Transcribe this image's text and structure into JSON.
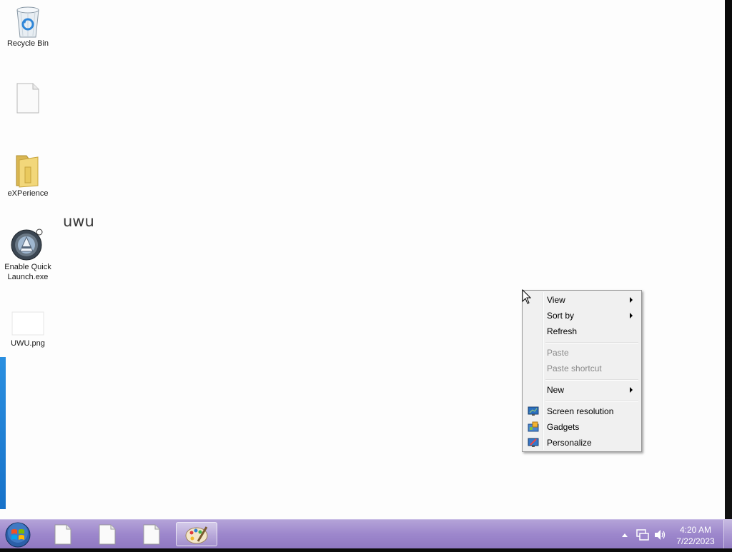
{
  "desktop": {
    "icons": [
      {
        "label": "Recycle Bin",
        "icon": "recycle-bin-icon"
      },
      {
        "label": "",
        "icon": "blank-file-icon"
      },
      {
        "label": "eXPerience",
        "icon": "folder-icon"
      },
      {
        "label": "Enable Quick Launch.exe",
        "icon": "app-launcher-icon"
      },
      {
        "label": "UWU.png",
        "icon": "image-file-icon"
      }
    ],
    "floating_text": "uwu"
  },
  "context_menu": {
    "items": [
      {
        "label": "View",
        "submenu": true,
        "enabled": true
      },
      {
        "label": "Sort by",
        "submenu": true,
        "enabled": true
      },
      {
        "label": "Refresh",
        "submenu": false,
        "enabled": true
      },
      {
        "label": "Paste",
        "submenu": false,
        "enabled": false
      },
      {
        "label": "Paste shortcut",
        "submenu": false,
        "enabled": false
      },
      {
        "label": "New",
        "submenu": true,
        "enabled": true
      },
      {
        "label": "Screen resolution",
        "submenu": false,
        "enabled": true,
        "icon": "screen-resolution-icon"
      },
      {
        "label": "Gadgets",
        "submenu": false,
        "enabled": true,
        "icon": "gadgets-icon"
      },
      {
        "label": "Personalize",
        "submenu": false,
        "enabled": true,
        "icon": "personalize-icon"
      }
    ]
  },
  "taskbar": {
    "start_icon": "windows-start-icon",
    "tasks": [
      {
        "icon": "document-icon",
        "active": false
      },
      {
        "icon": "document-icon",
        "active": false
      },
      {
        "icon": "document-icon",
        "active": false
      },
      {
        "icon": "paint-palette-icon",
        "active": true
      }
    ],
    "tray_icons": [
      "show-hidden-icons-icon",
      "network-icon",
      "volume-icon"
    ],
    "clock": {
      "time": "4:20 AM",
      "date": "7/22/2023"
    }
  },
  "colors": {
    "taskbar": "#9d87cc",
    "desktop_background": "#fdfdfd",
    "menu_background": "#f0f0f0"
  }
}
